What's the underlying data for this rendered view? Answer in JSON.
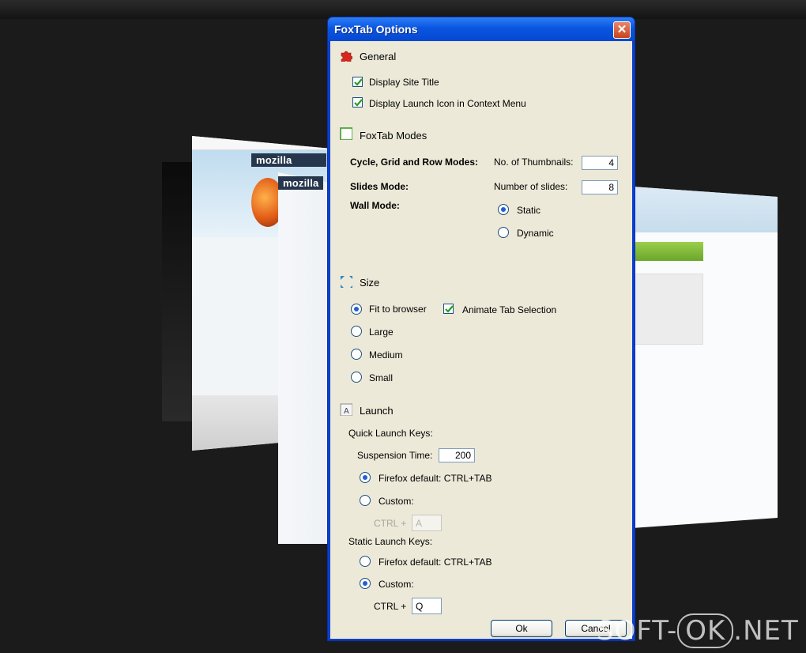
{
  "dialog": {
    "title": "FoxTab Options",
    "close_glyph": "✕",
    "general": {
      "header": "General",
      "display_site_title": {
        "label": "Display Site Title",
        "checked": true
      },
      "display_launch_icon": {
        "label": "Display Launch Icon in Context Menu",
        "checked": true
      }
    },
    "modes": {
      "header": "FoxTab Modes",
      "cycle_label": "Cycle, Grid and Row Modes:",
      "thumbnails_label": "No. of Thumbnails:",
      "thumbnails_value": "4",
      "slides_label": "Slides Mode:",
      "slides_count_label": "Number of slides:",
      "slides_value": "8",
      "wall_label": "Wall Mode:",
      "wall_options": [
        {
          "label": "Static",
          "selected": true
        },
        {
          "label": "Dynamic",
          "selected": false
        }
      ]
    },
    "size": {
      "header": "Size",
      "options": [
        {
          "label": "Fit to browser",
          "selected": true
        },
        {
          "label": "Large",
          "selected": false
        },
        {
          "label": "Medium",
          "selected": false
        },
        {
          "label": "Small",
          "selected": false
        }
      ],
      "animate": {
        "label": "Animate Tab Selection",
        "checked": true
      }
    },
    "launch": {
      "header": "Launch",
      "quick_label": "Quick Launch Keys:",
      "suspension_label": "Suspension Time:",
      "suspension_value": "200",
      "quick_options": [
        {
          "label": "Firefox default: CTRL+TAB",
          "selected": true
        },
        {
          "label": "Custom:",
          "selected": false
        }
      ],
      "quick_ctrl_label": "CTRL +",
      "quick_ctrl_value": "A",
      "static_label": "Static Launch Keys:",
      "static_options": [
        {
          "label": "Firefox default: CTRL+TAB",
          "selected": false
        },
        {
          "label": "Custom:",
          "selected": true
        }
      ],
      "static_ctrl_label": "CTRL +",
      "static_ctrl_value": "Q"
    },
    "ok_label": "Ok",
    "cancel_label": "Cancel"
  },
  "background": {
    "mozilla_label_1": "mozilla",
    "mozilla_label_2": "mozilla"
  },
  "watermark": {
    "part1": "SOFT-",
    "part2": "OK",
    "part3": ".NET"
  },
  "colors": {
    "titlebar": "#0a55e0",
    "dialog_body": "#ece9d8",
    "radio_dot": "#1f5ed6"
  }
}
